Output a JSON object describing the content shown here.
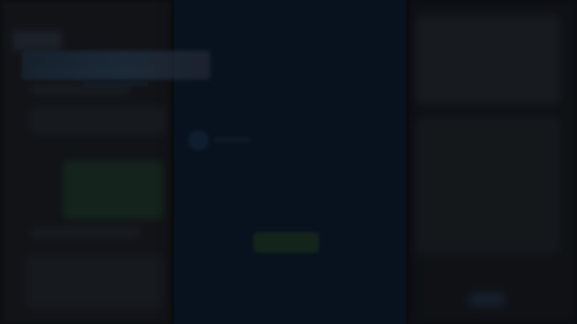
{
  "colors": {
    "backdrop": "#0b0f14",
    "left_panel": "#1a1d21",
    "right_panel": "#15191d",
    "dialog_background": "#0a1a2c",
    "accent_green": "#1d3a24"
  },
  "dialog": {
    "title": "",
    "button_label": ""
  },
  "icons": {
    "dialog_icon": "blurred-circle-icon"
  }
}
